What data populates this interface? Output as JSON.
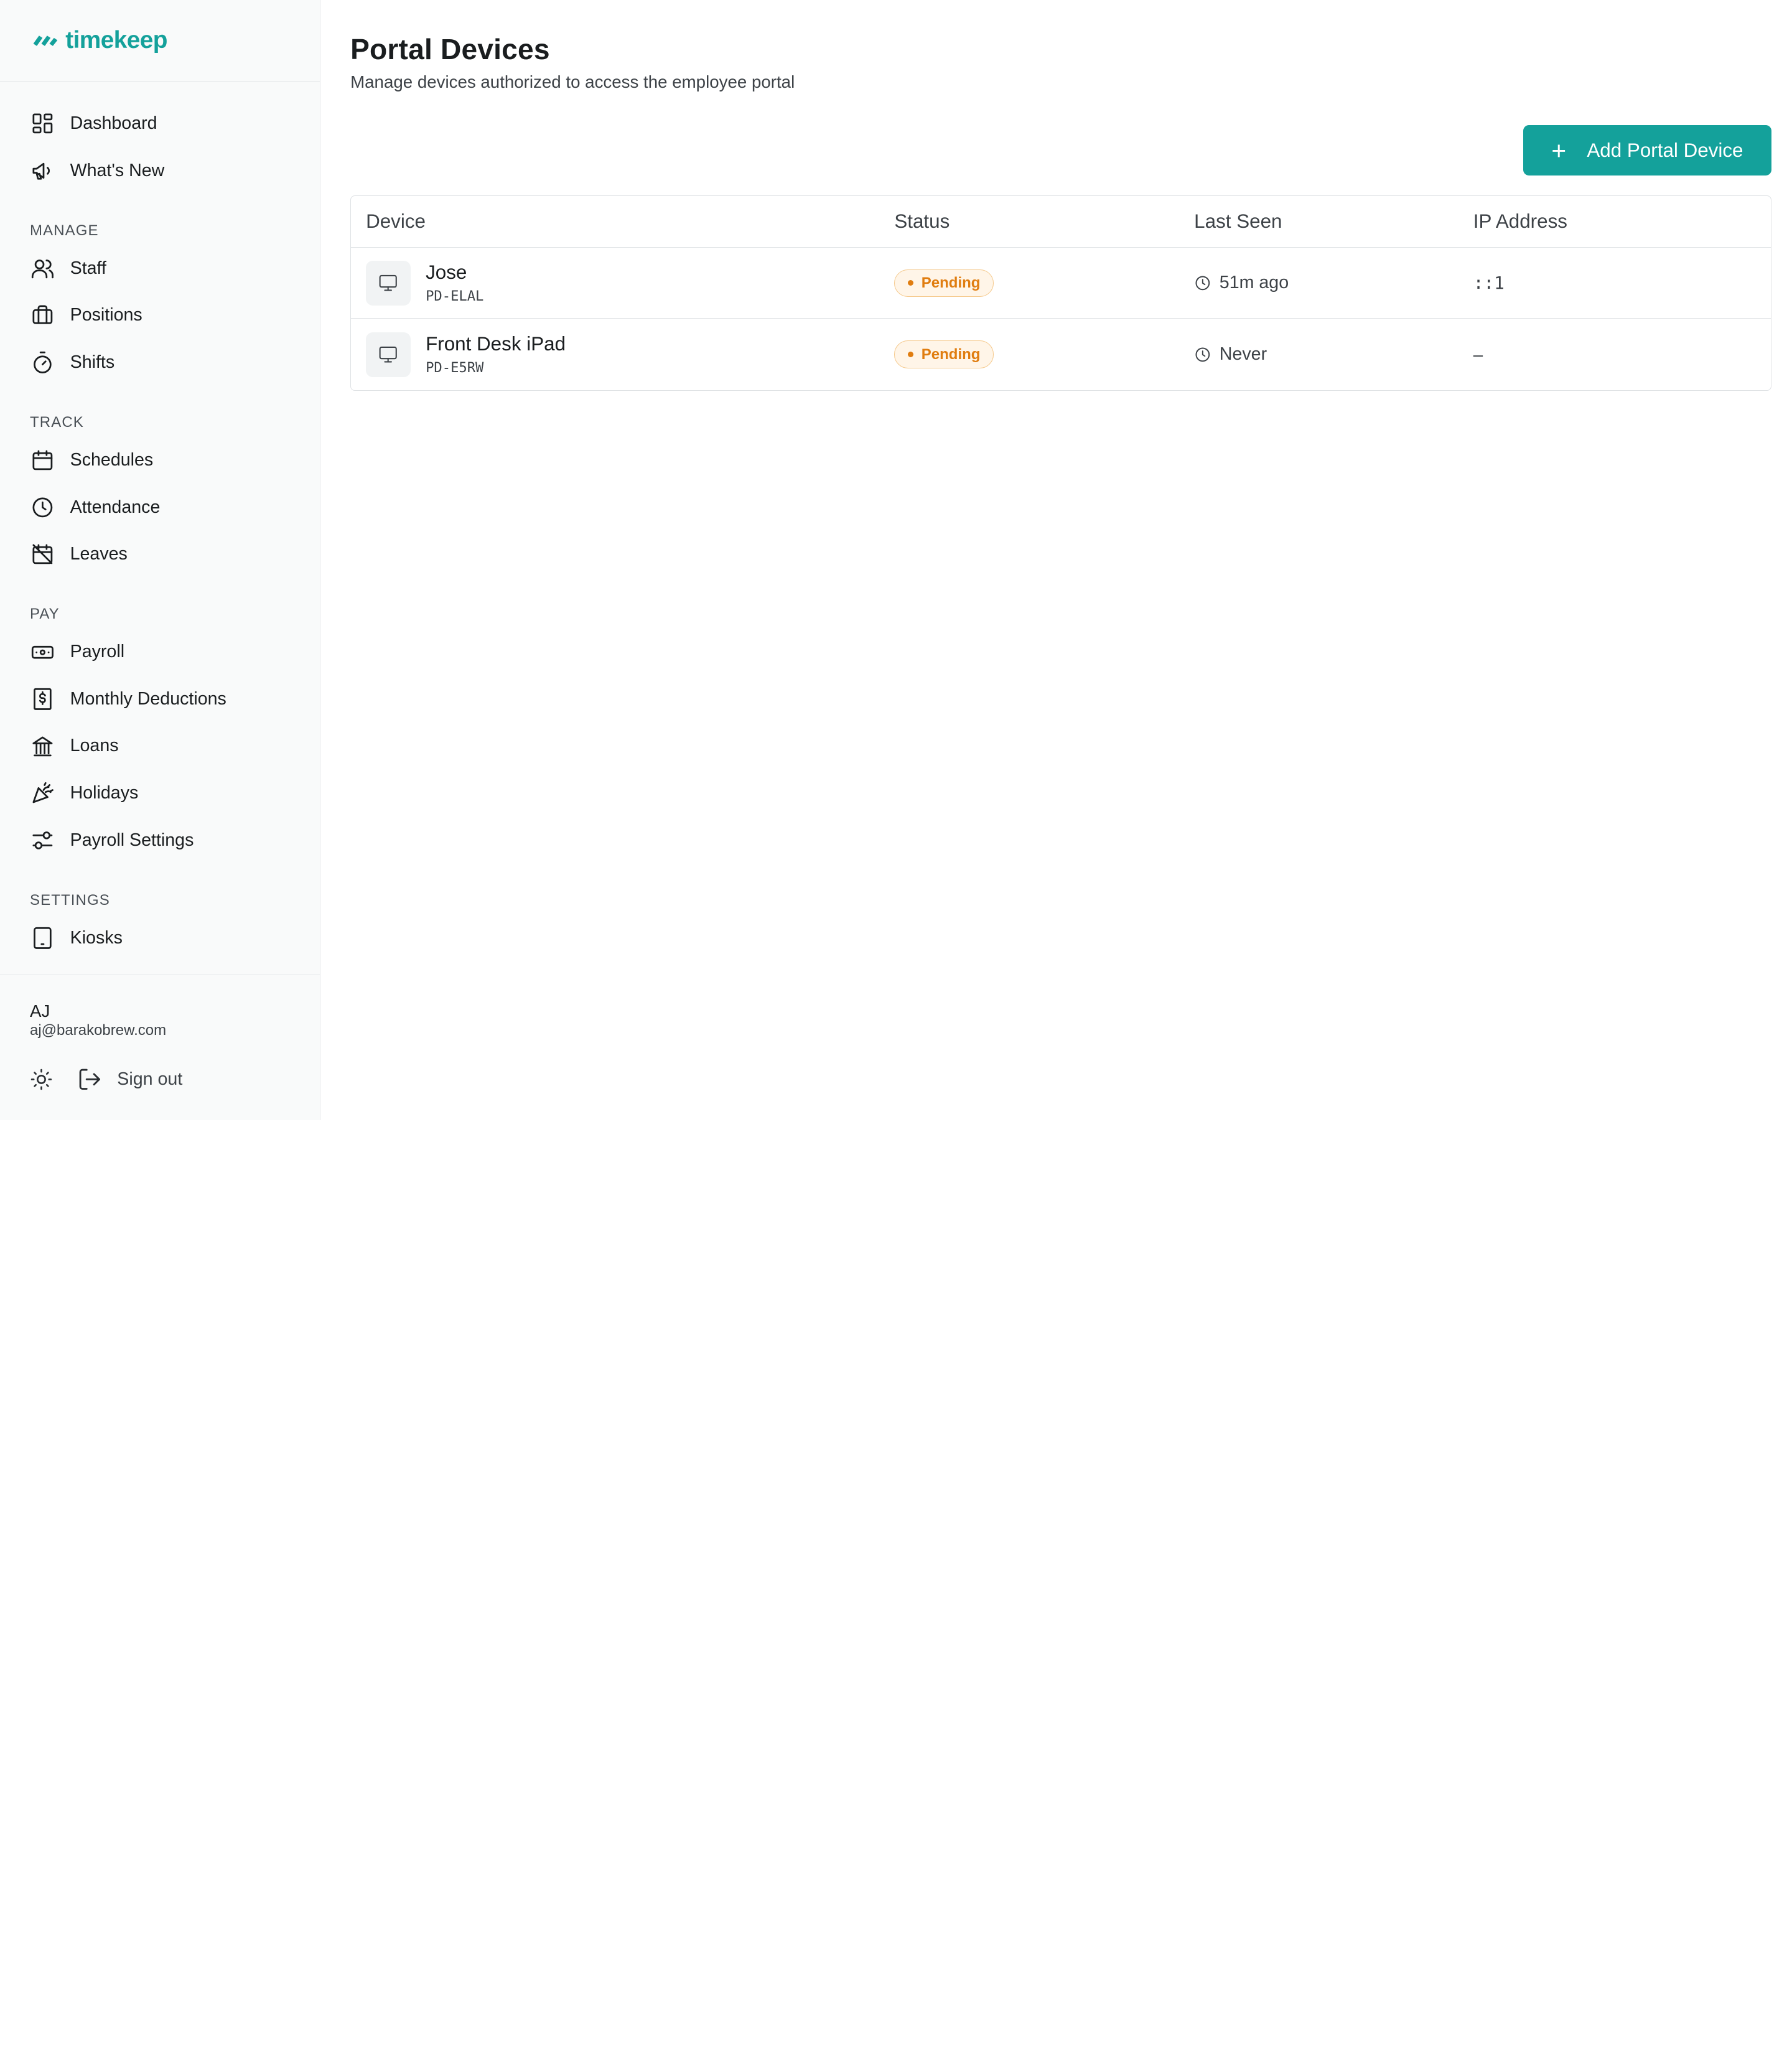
{
  "brand": {
    "name": "timekeep",
    "color": "#14a19b"
  },
  "sidebar": {
    "top_items": [
      {
        "label": "Dashboard",
        "icon": "dashboard-icon"
      },
      {
        "label": "What's New",
        "icon": "megaphone-icon"
      }
    ],
    "sections": [
      {
        "title": "MANAGE",
        "items": [
          {
            "label": "Staff",
            "icon": "users-icon"
          },
          {
            "label": "Positions",
            "icon": "briefcase-icon"
          },
          {
            "label": "Shifts",
            "icon": "stopwatch-icon"
          }
        ]
      },
      {
        "title": "TRACK",
        "items": [
          {
            "label": "Schedules",
            "icon": "calendar-icon"
          },
          {
            "label": "Attendance",
            "icon": "clock-icon"
          },
          {
            "label": "Leaves",
            "icon": "calendar-off-icon"
          }
        ]
      },
      {
        "title": "PAY",
        "items": [
          {
            "label": "Payroll",
            "icon": "cash-icon"
          },
          {
            "label": "Monthly Deductions",
            "icon": "receipt-dollar-icon"
          },
          {
            "label": "Loans",
            "icon": "bank-icon"
          },
          {
            "label": "Holidays",
            "icon": "party-popper-icon"
          },
          {
            "label": "Payroll Settings",
            "icon": "sliders-icon"
          }
        ]
      },
      {
        "title": "SETTINGS",
        "items": [
          {
            "label": "Kiosks",
            "icon": "tablet-icon"
          }
        ]
      }
    ],
    "user": {
      "initials": "AJ",
      "email": "aj@barakobrew.com"
    },
    "sign_out_label": "Sign out"
  },
  "main": {
    "title": "Portal Devices",
    "subtitle": "Manage devices authorized to access the employee portal",
    "add_button_label": "Add Portal Device",
    "table": {
      "columns": [
        "Device",
        "Status",
        "Last Seen",
        "IP Address"
      ],
      "rows": [
        {
          "name": "Jose",
          "code": "PD-ELAL",
          "status": "Pending",
          "last_seen": "51m ago",
          "ip": "::1"
        },
        {
          "name": "Front Desk iPad",
          "code": "PD-E5RW",
          "status": "Pending",
          "last_seen": "Never",
          "ip": "–"
        }
      ]
    }
  },
  "colors": {
    "accent": "#14a19b",
    "pending": "#e07d10",
    "pending_bg": "#fff5e8"
  }
}
